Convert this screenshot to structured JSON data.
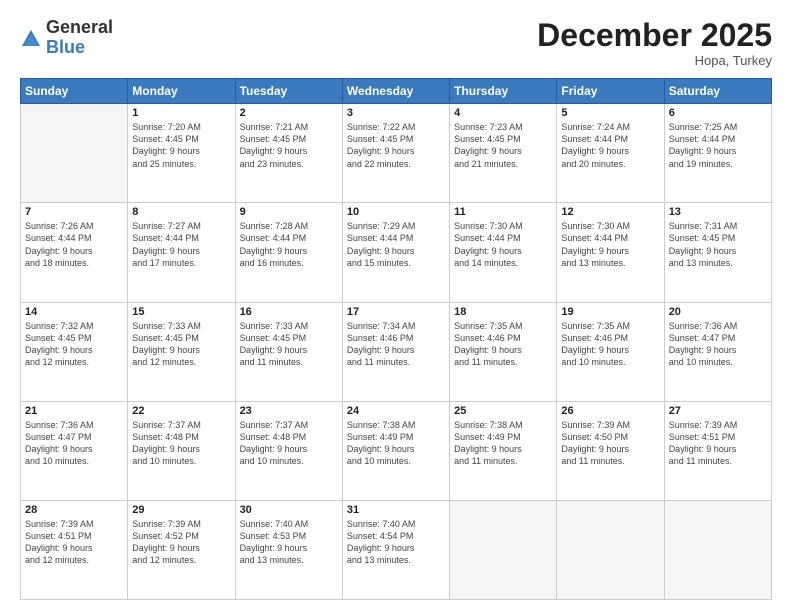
{
  "logo": {
    "general": "General",
    "blue": "Blue"
  },
  "title": "December 2025",
  "location": "Hopa, Turkey",
  "days_header": [
    "Sunday",
    "Monday",
    "Tuesday",
    "Wednesday",
    "Thursday",
    "Friday",
    "Saturday"
  ],
  "weeks": [
    [
      {
        "day": "",
        "info": ""
      },
      {
        "day": "1",
        "info": "Sunrise: 7:20 AM\nSunset: 4:45 PM\nDaylight: 9 hours\nand 25 minutes."
      },
      {
        "day": "2",
        "info": "Sunrise: 7:21 AM\nSunset: 4:45 PM\nDaylight: 9 hours\nand 23 minutes."
      },
      {
        "day": "3",
        "info": "Sunrise: 7:22 AM\nSunset: 4:45 PM\nDaylight: 9 hours\nand 22 minutes."
      },
      {
        "day": "4",
        "info": "Sunrise: 7:23 AM\nSunset: 4:45 PM\nDaylight: 9 hours\nand 21 minutes."
      },
      {
        "day": "5",
        "info": "Sunrise: 7:24 AM\nSunset: 4:44 PM\nDaylight: 9 hours\nand 20 minutes."
      },
      {
        "day": "6",
        "info": "Sunrise: 7:25 AM\nSunset: 4:44 PM\nDaylight: 9 hours\nand 19 minutes."
      }
    ],
    [
      {
        "day": "7",
        "info": "Sunrise: 7:26 AM\nSunset: 4:44 PM\nDaylight: 9 hours\nand 18 minutes."
      },
      {
        "day": "8",
        "info": "Sunrise: 7:27 AM\nSunset: 4:44 PM\nDaylight: 9 hours\nand 17 minutes."
      },
      {
        "day": "9",
        "info": "Sunrise: 7:28 AM\nSunset: 4:44 PM\nDaylight: 9 hours\nand 16 minutes."
      },
      {
        "day": "10",
        "info": "Sunrise: 7:29 AM\nSunset: 4:44 PM\nDaylight: 9 hours\nand 15 minutes."
      },
      {
        "day": "11",
        "info": "Sunrise: 7:30 AM\nSunset: 4:44 PM\nDaylight: 9 hours\nand 14 minutes."
      },
      {
        "day": "12",
        "info": "Sunrise: 7:30 AM\nSunset: 4:44 PM\nDaylight: 9 hours\nand 13 minutes."
      },
      {
        "day": "13",
        "info": "Sunrise: 7:31 AM\nSunset: 4:45 PM\nDaylight: 9 hours\nand 13 minutes."
      }
    ],
    [
      {
        "day": "14",
        "info": "Sunrise: 7:32 AM\nSunset: 4:45 PM\nDaylight: 9 hours\nand 12 minutes."
      },
      {
        "day": "15",
        "info": "Sunrise: 7:33 AM\nSunset: 4:45 PM\nDaylight: 9 hours\nand 12 minutes."
      },
      {
        "day": "16",
        "info": "Sunrise: 7:33 AM\nSunset: 4:45 PM\nDaylight: 9 hours\nand 11 minutes."
      },
      {
        "day": "17",
        "info": "Sunrise: 7:34 AM\nSunset: 4:46 PM\nDaylight: 9 hours\nand 11 minutes."
      },
      {
        "day": "18",
        "info": "Sunrise: 7:35 AM\nSunset: 4:46 PM\nDaylight: 9 hours\nand 11 minutes."
      },
      {
        "day": "19",
        "info": "Sunrise: 7:35 AM\nSunset: 4:46 PM\nDaylight: 9 hours\nand 10 minutes."
      },
      {
        "day": "20",
        "info": "Sunrise: 7:36 AM\nSunset: 4:47 PM\nDaylight: 9 hours\nand 10 minutes."
      }
    ],
    [
      {
        "day": "21",
        "info": "Sunrise: 7:36 AM\nSunset: 4:47 PM\nDaylight: 9 hours\nand 10 minutes."
      },
      {
        "day": "22",
        "info": "Sunrise: 7:37 AM\nSunset: 4:48 PM\nDaylight: 9 hours\nand 10 minutes."
      },
      {
        "day": "23",
        "info": "Sunrise: 7:37 AM\nSunset: 4:48 PM\nDaylight: 9 hours\nand 10 minutes."
      },
      {
        "day": "24",
        "info": "Sunrise: 7:38 AM\nSunset: 4:49 PM\nDaylight: 9 hours\nand 10 minutes."
      },
      {
        "day": "25",
        "info": "Sunrise: 7:38 AM\nSunset: 4:49 PM\nDaylight: 9 hours\nand 11 minutes."
      },
      {
        "day": "26",
        "info": "Sunrise: 7:39 AM\nSunset: 4:50 PM\nDaylight: 9 hours\nand 11 minutes."
      },
      {
        "day": "27",
        "info": "Sunrise: 7:39 AM\nSunset: 4:51 PM\nDaylight: 9 hours\nand 11 minutes."
      }
    ],
    [
      {
        "day": "28",
        "info": "Sunrise: 7:39 AM\nSunset: 4:51 PM\nDaylight: 9 hours\nand 12 minutes."
      },
      {
        "day": "29",
        "info": "Sunrise: 7:39 AM\nSunset: 4:52 PM\nDaylight: 9 hours\nand 12 minutes."
      },
      {
        "day": "30",
        "info": "Sunrise: 7:40 AM\nSunset: 4:53 PM\nDaylight: 9 hours\nand 13 minutes."
      },
      {
        "day": "31",
        "info": "Sunrise: 7:40 AM\nSunset: 4:54 PM\nDaylight: 9 hours\nand 13 minutes."
      },
      {
        "day": "",
        "info": ""
      },
      {
        "day": "",
        "info": ""
      },
      {
        "day": "",
        "info": ""
      }
    ]
  ]
}
